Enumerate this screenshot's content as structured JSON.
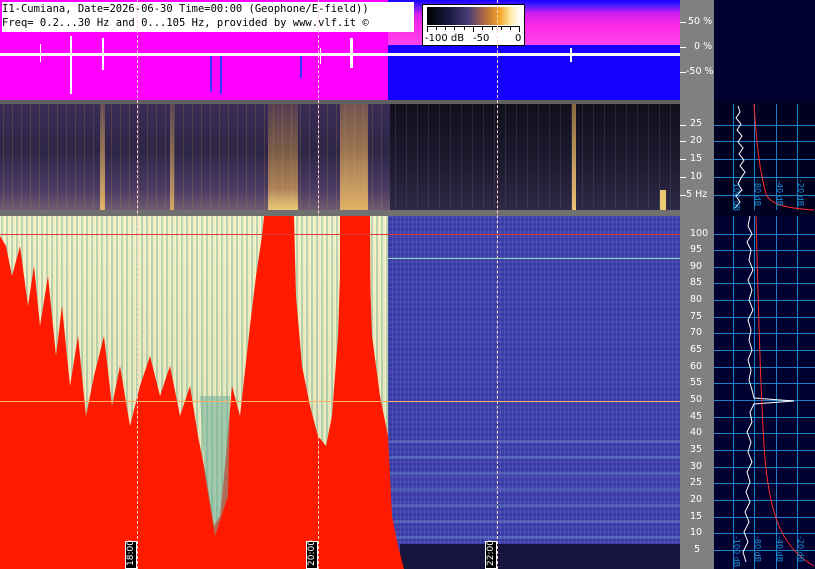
{
  "header": {
    "line1": "I1-Cumiana, Date=2026-06-30 Time=00:00 (Geophone/E-field))",
    "line2": "Freq= 0.2...30 Hz and 0...105 Hz, provided by www.vlf.it ©"
  },
  "color_scale": {
    "labels": [
      "-100 dB",
      "-50",
      "0"
    ]
  },
  "waveform_axis": {
    "labels": [
      "50 %",
      "0 %",
      "-50 %"
    ]
  },
  "low_freq_axis": {
    "labels": [
      "25",
      "20",
      "15",
      "10",
      "5 Hz"
    ]
  },
  "high_freq_axis": {
    "labels": [
      "100",
      "95",
      "90",
      "85",
      "80",
      "75",
      "70",
      "65",
      "60",
      "55",
      "50",
      "45",
      "40",
      "35",
      "30",
      "25",
      "20",
      "15",
      "10",
      "5"
    ]
  },
  "time_markers": {
    "labels": [
      "18:00",
      "20:00",
      "22:00"
    ]
  },
  "profile_panel": {
    "db_labels_upper": [
      "-100 dB",
      "-80 dB",
      "-40 dB",
      "-20 dB"
    ],
    "db_labels_lower": [
      "-100 dB",
      "-80 dB",
      "-40 dB",
      "-20 dB"
    ]
  },
  "colors": {
    "waveform_magenta": "#ff00ff",
    "waveform_blue": "#1500ff",
    "saturation_red": "#ff1a00",
    "grid_blue": "#1c8fd6",
    "axis_gray": "#808080"
  }
}
